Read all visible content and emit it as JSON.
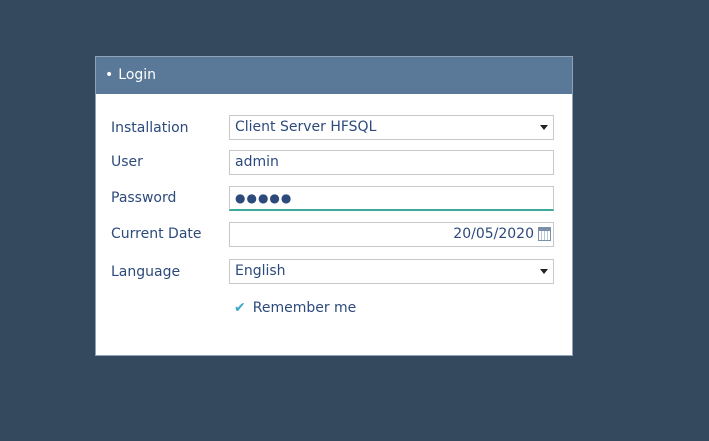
{
  "dialog": {
    "title": "Login"
  },
  "form": {
    "installation": {
      "label": "Installation",
      "value": "Client Server HFSQL"
    },
    "user": {
      "label": "User",
      "value": "admin"
    },
    "password": {
      "label": "Password",
      "value": "●●●●●"
    },
    "current_date": {
      "label": "Current Date",
      "value": "20/05/2020"
    },
    "language": {
      "label": "Language",
      "value": "English"
    },
    "remember": {
      "label": "Remember me",
      "checked": true
    }
  },
  "colors": {
    "background": "#34495e",
    "header": "#5a7898",
    "text": "#2c4a7c",
    "focus_accent": "#3aa89a"
  }
}
